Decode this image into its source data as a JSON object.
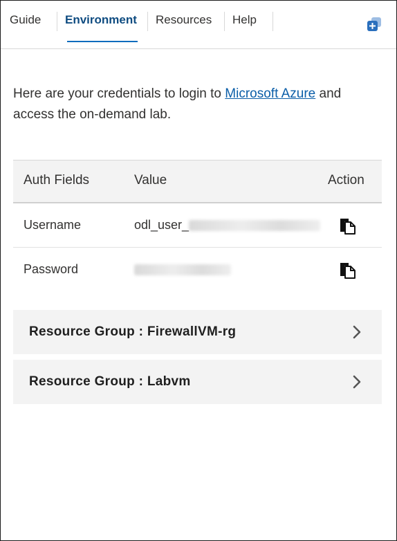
{
  "tabs": [
    {
      "label": "Guide",
      "active": false
    },
    {
      "label": "Environment",
      "active": true
    },
    {
      "label": "Resources",
      "active": false
    },
    {
      "label": "Help",
      "active": false
    }
  ],
  "corner_button": {
    "icon": "add-window-icon"
  },
  "intro": {
    "text_before": "Here are your credentials to login to ",
    "link": "Microsoft Azure",
    "text_after": " and access the on-demand lab."
  },
  "table": {
    "headers": [
      "Auth Fields",
      "Value",
      "Action"
    ],
    "rows": [
      {
        "field": "Username",
        "value_visible": "odl_user_",
        "value_redacted": true,
        "action_icon": "copy-icon"
      },
      {
        "field": "Password",
        "value_visible": "",
        "value_redacted": true,
        "action_icon": "copy-icon"
      }
    ]
  },
  "resource_groups": [
    {
      "label": "Resource Group : FirewallVM-rg",
      "icon": "chevron-right-icon"
    },
    {
      "label": "Resource Group : Labvm",
      "icon": "chevron-right-icon"
    }
  ],
  "colors": {
    "active_tab": "#0f4c81",
    "link": "#0b5ea8",
    "header_bg": "#f3f3f3",
    "accent_button": "#2a6fbd"
  }
}
